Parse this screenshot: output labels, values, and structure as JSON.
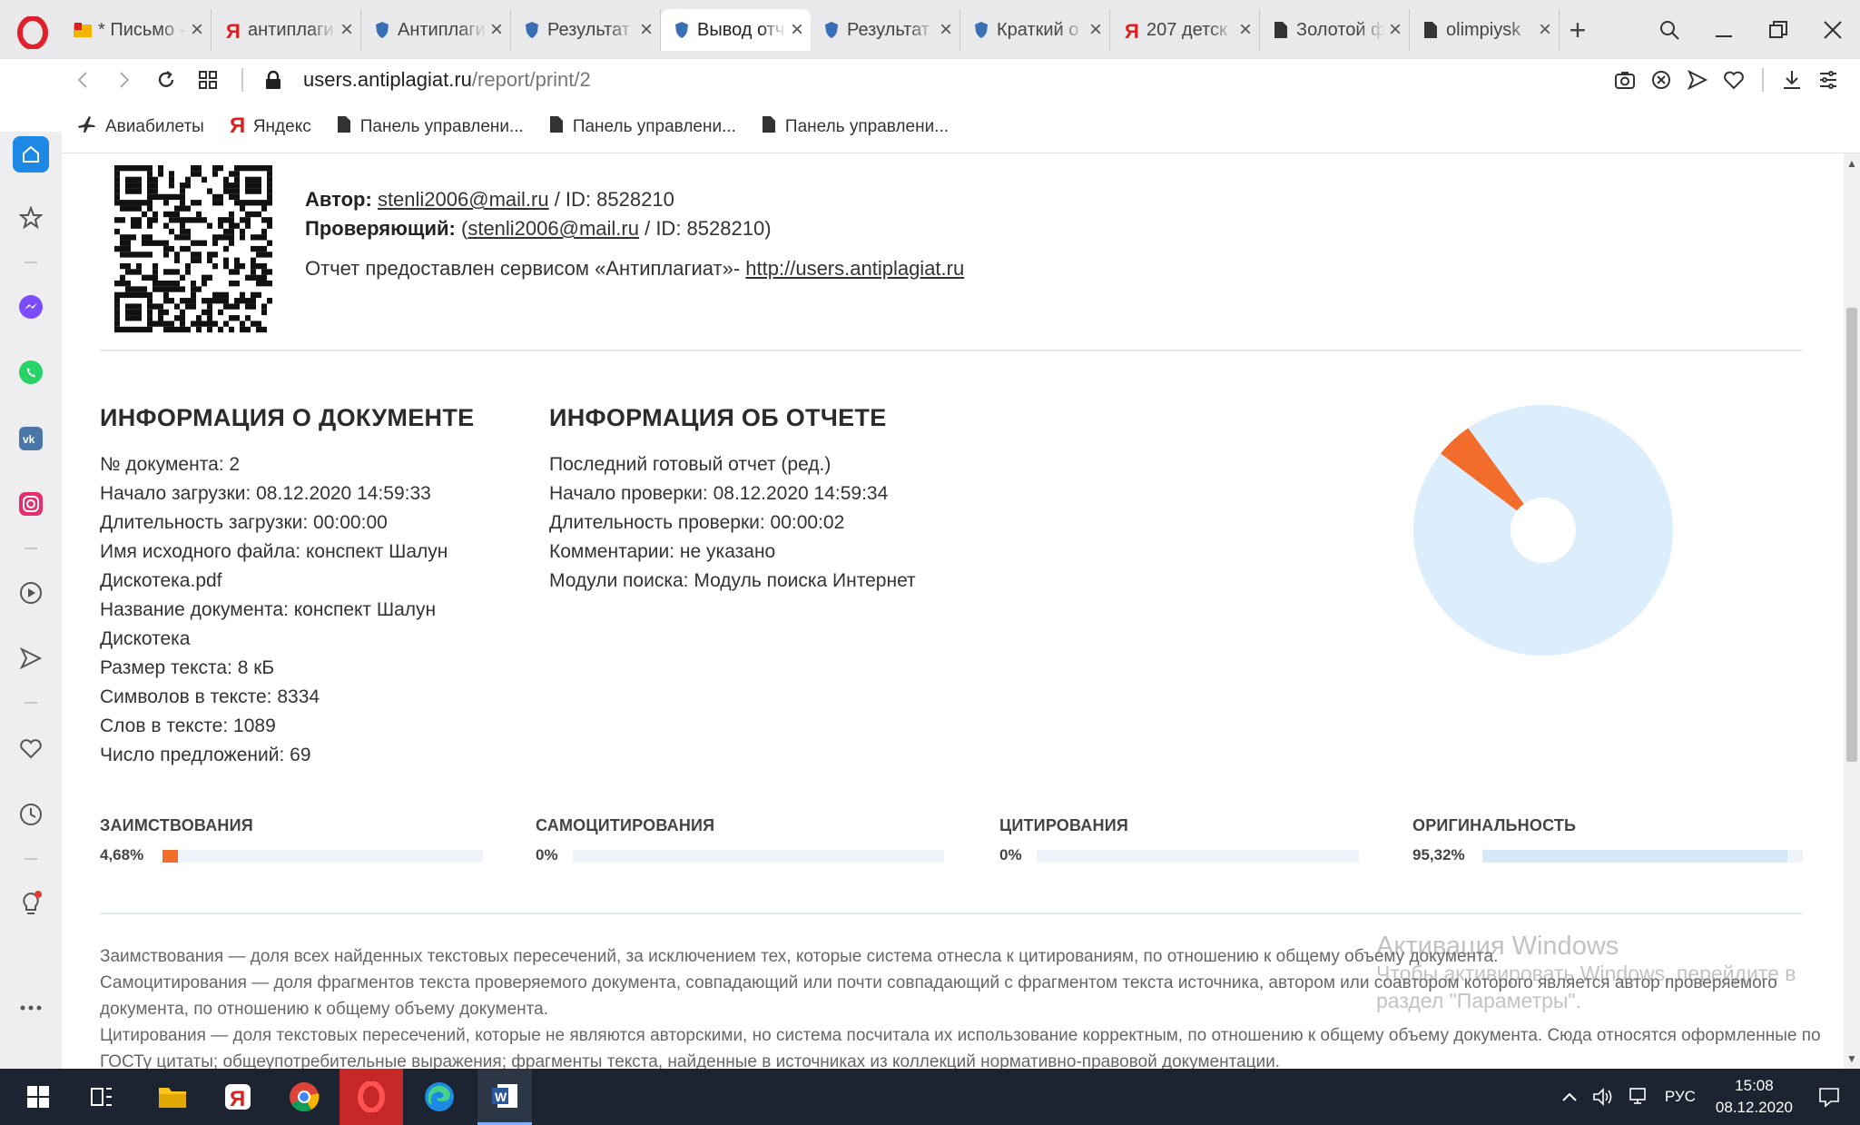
{
  "browser": {
    "tabs": [
      {
        "title": "* Письмо - ",
        "icon": "mail-icon"
      },
      {
        "title": "антиплаги",
        "icon": "yandex-icon"
      },
      {
        "title": "Антиплаги",
        "icon": "shield-icon"
      },
      {
        "title": "Результат",
        "icon": "shield-icon"
      },
      {
        "title": "Вывод отч",
        "icon": "shield-icon",
        "active": true
      },
      {
        "title": "Результат",
        "icon": "shield-icon"
      },
      {
        "title": "Краткий о",
        "icon": "shield-icon"
      },
      {
        "title": "207 детск",
        "icon": "yandex-icon"
      },
      {
        "title": "Золотой ф",
        "icon": "document-icon"
      },
      {
        "title": "olimpiysk",
        "icon": "document-icon"
      }
    ],
    "url_host": "users.antiplagiat.ru",
    "url_path": "/report/print/2",
    "bookmarks": [
      {
        "label": "Авиабилеты",
        "icon": "plane-icon"
      },
      {
        "label": "Яндекс",
        "icon": "yandex-icon"
      },
      {
        "label": "Панель управлени...",
        "icon": "document-icon"
      },
      {
        "label": "Панель управлени...",
        "icon": "document-icon"
      },
      {
        "label": "Панель управлени...",
        "icon": "document-icon"
      }
    ]
  },
  "report": {
    "author_label": "Автор:",
    "author_email": "stenli2006@mail.ru",
    "author_id": " / ID: 8528210",
    "reviewer_label": "Проверяющий:",
    "reviewer_open": " (",
    "reviewer_email": "stenli2006@mail.ru",
    "reviewer_id": " / ID: 8528210)",
    "provided_text": "Отчет предоставлен сервисом «Антиплагиат»- ",
    "provided_link": "http://users.antiplagiat.ru",
    "doc_info_title": "ИНФОРМАЦИЯ О ДОКУМЕНТЕ",
    "doc_info": [
      "№ документа: 2",
      "Начало загрузки: 08.12.2020 14:59:33",
      "Длительность загрузки: 00:00:00",
      "Имя исходного файла: конспект Шалун Дискотека.pdf",
      "Название документа: конспект Шалун Дискотека",
      "Размер текста: 8 кБ",
      "Символов в тексте: 8334",
      "Слов в тексте: 1089",
      "Число предложений: 69"
    ],
    "report_info_title": "ИНФОРМАЦИЯ ОБ ОТЧЕТЕ",
    "report_info": [
      "Последний готовый отчет (ред.)",
      "Начало проверки: 08.12.2020 14:59:34",
      "Длительность проверки: 00:00:02",
      "Комментарии: не указано",
      "Модули поиска: Модуль поиска Интернет"
    ],
    "stats": [
      {
        "label": "ЗАИМСТВОВАНИЯ",
        "value": "4,68%",
        "fraction": 0.0468,
        "color": "#f26c2c"
      },
      {
        "label": "САМОЦИТИРОВАНИЯ",
        "value": "0%",
        "fraction": 0,
        "color": "#f5a623"
      },
      {
        "label": "ЦИТИРОВАНИЯ",
        "value": "0%",
        "fraction": 0,
        "color": "#4caf50"
      },
      {
        "label": "ОРИГИНАЛЬНОСТЬ",
        "value": "95,32%",
        "fraction": 0.9532,
        "color": "#d6e9f8"
      }
    ],
    "legend": [
      "Заимствования — доля всех найденных текстовых пересечений, за исключением тех, которые система отнесла к цитированиям, по отношению к общему объему документа.",
      "Самоцитирования — доля фрагментов текста проверяемого документа, совпадающий или почти совпадающий с фрагментом текста источника, автором или соавтором которого является автор проверяемого документа, по отношению к общему объему документа.",
      "Цитирования — доля текстовых пересечений, которые не являются авторскими, но система посчитала их использование корректным, по отношению к общему объему документа. Сюда относятся оформленные по ГОСТу цитаты; общеупотребительные выражения; фрагменты текста, найденные в источниках из коллекций нормативно-правовой документации."
    ]
  },
  "watermark": {
    "title": "Активация Windows",
    "line1": "Чтобы активировать Windows, перейдите в",
    "line2": "раздел \"Параметры\"."
  },
  "taskbar": {
    "language": "РУС",
    "time": "15:08",
    "date": "08.12.2020"
  },
  "colors": {
    "borrowed": "#f26c2c",
    "original": "#d6e9f8",
    "sidebar_home": "#1e88e5"
  }
}
